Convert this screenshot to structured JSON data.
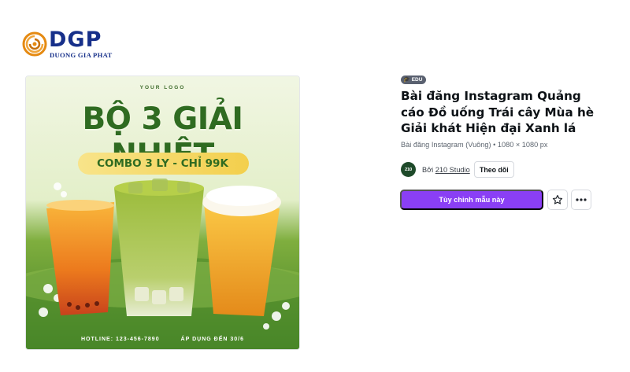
{
  "logo": {
    "brand": "DGP",
    "subtitle": "DUONG GIA PHAT",
    "colors": {
      "blue": "#17308a",
      "orange": "#e58a12"
    }
  },
  "preview": {
    "your_logo": "YOUR LOGO",
    "headline": "BỘ 3 GIẢI NHIỆT",
    "combo": "COMBO 3 LY - CHỈ 99K",
    "hotline": "HOTLINE: 123-456-7890",
    "apply": "ÁP DỤNG ĐẾN 30/6"
  },
  "details": {
    "badge": "EDU",
    "title": "Bài đăng Instagram Quảng cáo Đồ uống Trái cây Mùa hè Giải khát Hiện đại Xanh lá",
    "meta": "Bài đăng Instagram (Vuông) • 1080 × 1080 px",
    "author": {
      "avatar_text": "210",
      "by_label": "Bởi",
      "name": "210 Studio",
      "follow_label": "Theo dõi"
    },
    "cta_label": "Tùy chỉnh mẫu này",
    "icons": {
      "favorite": "star-icon",
      "more": "more-icon"
    },
    "colors": {
      "cta": "#8a3ff5",
      "title": "#0d1216"
    }
  }
}
